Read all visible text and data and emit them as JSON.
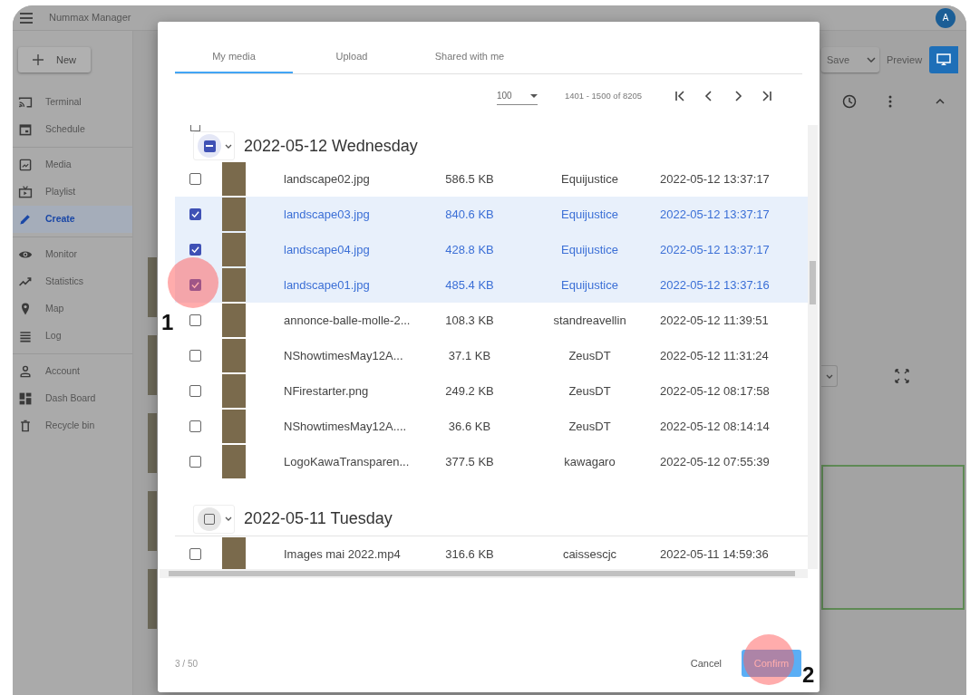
{
  "app": {
    "title": "Nummax Manager",
    "avatar": "A",
    "new_button": "New",
    "sidebar_sections": [
      {
        "items": [
          {
            "label": "Terminal",
            "kind": "cast",
            "selected": false
          },
          {
            "label": "Schedule",
            "kind": "calendar",
            "selected": false
          }
        ]
      },
      {
        "items": [
          {
            "label": "Media",
            "kind": "image",
            "selected": false
          },
          {
            "label": "Playlist",
            "kind": "tv",
            "selected": false
          },
          {
            "label": "Create",
            "kind": "pencil",
            "selected": true
          }
        ]
      },
      {
        "items": [
          {
            "label": "Monitor",
            "kind": "eye",
            "selected": false
          },
          {
            "label": "Statistics",
            "kind": "trend",
            "selected": false
          },
          {
            "label": "Map",
            "kind": "pin",
            "selected": false
          },
          {
            "label": "Log",
            "kind": "lines",
            "selected": false
          }
        ]
      },
      {
        "items": [
          {
            "label": "Account",
            "kind": "person",
            "selected": false
          },
          {
            "label": "Dash Board",
            "kind": "dashboard",
            "selected": false
          },
          {
            "label": "Recycle bin",
            "kind": "trash",
            "selected": false
          }
        ]
      }
    ],
    "toolbar": {
      "save": "Save",
      "preview": "Preview"
    }
  },
  "dialog": {
    "tabs": [
      {
        "label": "My media",
        "selected": true
      },
      {
        "label": "Upload",
        "selected": false
      },
      {
        "label": "Shared with me",
        "selected": false
      }
    ],
    "page_size": "100",
    "range": "1401 - 1500 of 8205",
    "select_all_checked": false,
    "groups": [
      {
        "title": "2022-05-12 Wednesday",
        "indeterminate": true,
        "rows": [
          {
            "name": "landscape02.jpg",
            "size": "586.5 KB",
            "owner": "Equijustice",
            "modified": "2022-05-12 13:37:17",
            "selected": false
          },
          {
            "name": "landscape03.jpg",
            "size": "840.6 KB",
            "owner": "Equijustice",
            "modified": "2022-05-12 13:37:17",
            "selected": true
          },
          {
            "name": "landscape04.jpg",
            "size": "428.8 KB",
            "owner": "Equijustice",
            "modified": "2022-05-12 13:37:17",
            "selected": true
          },
          {
            "name": "landscape01.jpg",
            "size": "485.4 KB",
            "owner": "Equijustice",
            "modified": "2022-05-12 13:37:16",
            "selected": true
          },
          {
            "name": "annonce-balle-molle-2...",
            "size": "108.3 KB",
            "owner": "standreavellin",
            "modified": "2022-05-12 11:39:51",
            "selected": false
          },
          {
            "name": "NShowtimesMay12A...",
            "size": "37.1 KB",
            "owner": "ZeusDT",
            "modified": "2022-05-12 11:31:24",
            "selected": false
          },
          {
            "name": "NFirestarter.png",
            "size": "249.2 KB",
            "owner": "ZeusDT",
            "modified": "2022-05-12 08:17:58",
            "selected": false
          },
          {
            "name": "NShowtimesMay12A....",
            "size": "36.6 KB",
            "owner": "ZeusDT",
            "modified": "2022-05-12 08:14:14",
            "selected": false
          },
          {
            "name": "LogoKawaTransparen...",
            "size": "377.5 KB",
            "owner": "kawagaro",
            "modified": "2022-05-12 07:55:39",
            "selected": false
          }
        ]
      },
      {
        "title": "2022-05-11 Tuesday",
        "indeterminate": false,
        "rows": [
          {
            "name": "Images mai 2022.mp4",
            "size": "316.6 KB",
            "owner": "caissescjc",
            "modified": "2022-05-11 14:59:36",
            "selected": false
          }
        ]
      }
    ],
    "count": "3 / 50",
    "cancel": "Cancel",
    "confirm": "Confirm"
  },
  "annotations": [
    {
      "label": "1"
    },
    {
      "label": "2"
    }
  ]
}
